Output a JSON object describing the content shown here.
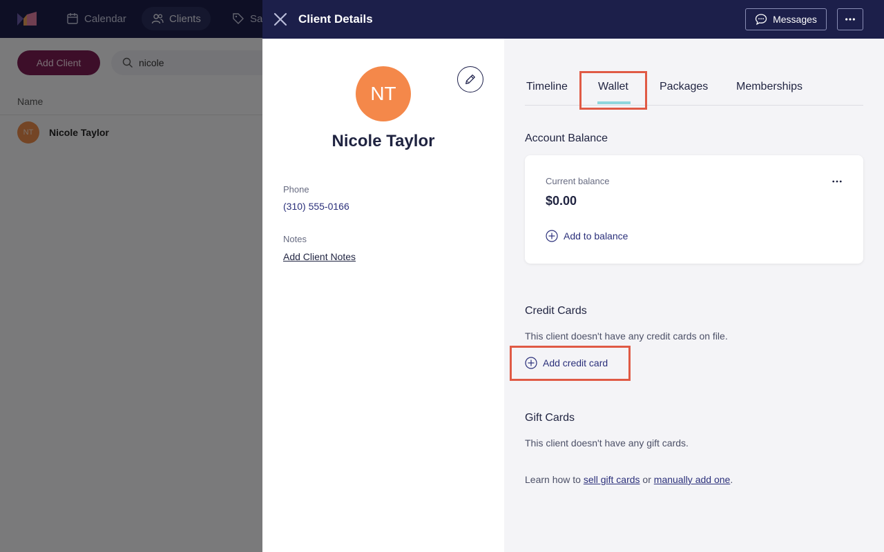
{
  "background": {
    "nav": [
      {
        "label": "Calendar",
        "icon": "calendar-icon"
      },
      {
        "label": "Clients",
        "icon": "users-icon"
      },
      {
        "label": "Sal",
        "icon": "tag-icon"
      }
    ],
    "add_client_label": "Add Client",
    "search_value": "nicole",
    "name_column": "Name",
    "client_row": {
      "initials": "NT",
      "name": "Nicole Taylor"
    }
  },
  "drawer": {
    "title": "Client Details",
    "messages_label": "Messages"
  },
  "client": {
    "initials": "NT",
    "name": "Nicole Taylor",
    "phone_label": "Phone",
    "phone": "(310) 555-0166",
    "notes_label": "Notes",
    "add_notes_label": "Add Client Notes"
  },
  "tabs": [
    {
      "label": "Timeline"
    },
    {
      "label": "Wallet",
      "active": true
    },
    {
      "label": "Packages"
    },
    {
      "label": "Memberships"
    }
  ],
  "wallet": {
    "account_balance_title": "Account Balance",
    "current_balance_label": "Current balance",
    "current_balance": "$0.00",
    "add_to_balance_label": "Add to balance",
    "credit_cards_title": "Credit Cards",
    "credit_cards_empty": "This client doesn't have any credit cards on file.",
    "add_credit_card_label": "Add credit card",
    "gift_cards_title": "Gift Cards",
    "gift_cards_empty": "This client doesn't have any gift cards.",
    "learn_prefix": "Learn how to ",
    "sell_gift_cards_link": "sell gift cards",
    "learn_middle": " or ",
    "manually_add_link": "manually add one",
    "learn_suffix": "."
  },
  "colors": {
    "header_bg": "#1c1f4a",
    "avatar": "#f4884a",
    "tab_underline": "#8fd6dc",
    "highlight": "#e05a45",
    "add_client_btn": "#7a1d52"
  }
}
